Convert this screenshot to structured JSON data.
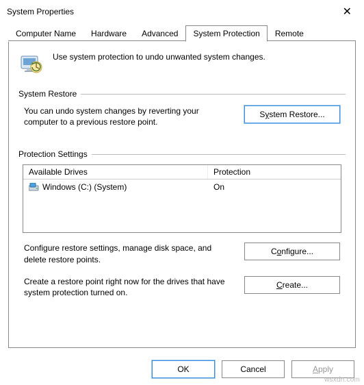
{
  "window": {
    "title": "System Properties",
    "close_glyph": "✕"
  },
  "tabs": {
    "items": [
      {
        "label": "Computer Name"
      },
      {
        "label": "Hardware"
      },
      {
        "label": "Advanced"
      },
      {
        "label": "System Protection"
      },
      {
        "label": "Remote"
      }
    ],
    "active_index": 3
  },
  "header": {
    "text": "Use system protection to undo unwanted system changes."
  },
  "restore": {
    "legend": "System Restore",
    "text": "You can undo system changes by reverting your computer to a previous restore point.",
    "button_pre": "S",
    "button_ul": "y",
    "button_post": "stem Restore..."
  },
  "protection": {
    "legend": "Protection Settings",
    "col_drives": "Available Drives",
    "col_prot": "Protection",
    "rows": [
      {
        "name": "Windows (C:) (System)",
        "status": "On"
      }
    ],
    "configure_text": "Configure restore settings, manage disk space, and delete restore points.",
    "configure_pre": "C",
    "configure_ul": "o",
    "configure_post": "nfigure...",
    "create_text": "Create a restore point right now for the drives that have system protection turned on.",
    "create_pre": "",
    "create_ul": "C",
    "create_post": "reate..."
  },
  "footer": {
    "ok": "OK",
    "cancel": "Cancel",
    "apply_pre": "",
    "apply_ul": "A",
    "apply_post": "pply"
  },
  "watermark": "wsxdn.com"
}
